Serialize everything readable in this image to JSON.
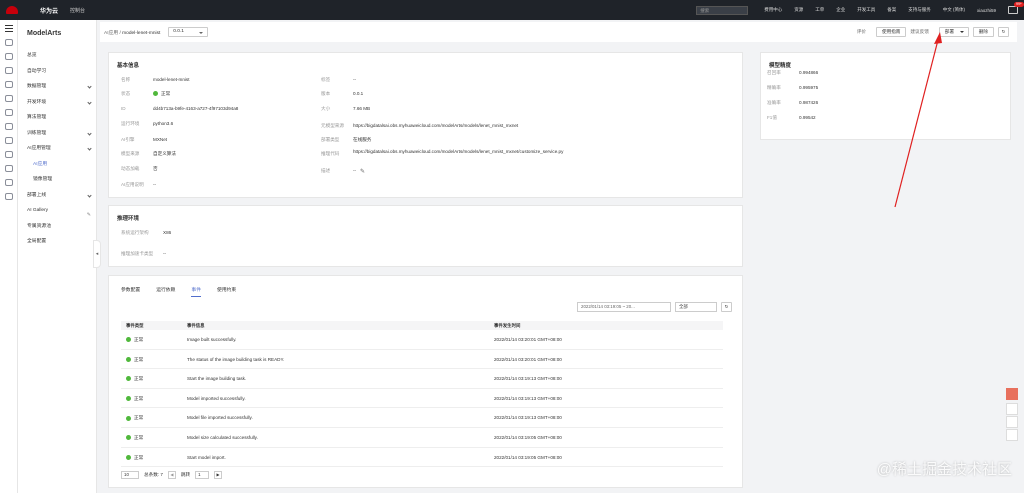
{
  "topbar": {
    "brand": "华为云",
    "console": "控制台",
    "search_placeholder": "搜索",
    "links": [
      "费用中心",
      "资源",
      "工单",
      "企业",
      "开发工具",
      "备案",
      "支持与服务",
      "中文 (简体)",
      "xiaozhi59"
    ],
    "msg_badge": "99+"
  },
  "sidebar": {
    "title": "ModelArts",
    "items": [
      {
        "label": "总览",
        "sub": false,
        "chevron": false
      },
      {
        "label": "自动学习",
        "sub": false,
        "chevron": false
      },
      {
        "label": "数据管理",
        "sub": false,
        "chevron": true
      },
      {
        "label": "开发环境",
        "sub": false,
        "chevron": true
      },
      {
        "label": "算法管理",
        "sub": false,
        "chevron": false
      },
      {
        "label": "训练管理",
        "sub": false,
        "chevron": true
      },
      {
        "label": "AI应用管理",
        "sub": false,
        "chevron": true
      },
      {
        "label": "AI应用",
        "sub": true,
        "active": true
      },
      {
        "label": "镜像管理",
        "sub": true
      },
      {
        "label": "部署上线",
        "sub": false,
        "chevron": true
      },
      {
        "label": "AI Gallery",
        "sub": false,
        "pen": true
      },
      {
        "label": "专属资源池",
        "sub": false
      },
      {
        "label": "全局配置",
        "sub": false
      }
    ]
  },
  "breadcrumb": {
    "parent": "AI应用",
    "separator": "/",
    "current": "model-lenet-mnist",
    "version": "0.0.1"
  },
  "toolbar": {
    "feedback": "评价",
    "guide": "使用指南",
    "prereq": "建议反馈",
    "deploy": "部署",
    "delete": "删除"
  },
  "basic_info": {
    "title": "基本信息",
    "left": [
      {
        "label": "名称",
        "value": "model-lenet-mnist"
      },
      {
        "label": "状态",
        "value": "正常",
        "status": "ok"
      },
      {
        "label": "ID",
        "value": "dd4b713a-b9fe-4163-a727-4f97103d94a8"
      },
      {
        "label": "运行环境",
        "value": "python3.6"
      },
      {
        "label": "AI引擎",
        "value": "MXNet"
      },
      {
        "label": "模型来源",
        "value": "自定义算法"
      },
      {
        "label": "动态加载",
        "value": "否"
      },
      {
        "label": "AI应用说明",
        "value": "--"
      }
    ],
    "right": [
      {
        "label": "标签",
        "value": "--"
      },
      {
        "label": "版本",
        "value": "0.0.1"
      },
      {
        "label": "大小",
        "value": "7.66 MB"
      },
      {
        "label": "元模型来源",
        "value": "https://bigdatalsai.obs.myhuaweicloud.com/modelArts/models/lenet_mnist_mxnet"
      },
      {
        "label": "部署类型",
        "value": "在线服务"
      },
      {
        "label": "推理代码",
        "value": "https://bigdatalsai.obs.myhuaweicloud.com/modelArts/models/lenet_mnist_mxnet/customize_service.py"
      },
      {
        "label": "描述",
        "value": "--"
      }
    ]
  },
  "inference_env": {
    "title": "推理环境",
    "rows": [
      {
        "label": "系统运行架构",
        "value": "X86"
      },
      {
        "label": "推理加速卡类型",
        "value": "--"
      }
    ]
  },
  "model_precision": {
    "title": "模型精度",
    "rows": [
      {
        "label": "召回率",
        "value": "0.994866"
      },
      {
        "label": "精确率",
        "value": "0.995975"
      },
      {
        "label": "准确率",
        "value": "0.987426"
      },
      {
        "label": "F1值",
        "value": "0.99542"
      }
    ]
  },
  "events": {
    "tabs": [
      "参数配置",
      "运行依赖",
      "事件",
      "使用约束"
    ],
    "active_tab": 2,
    "date_range": "2022/01/14 03:19:05  ~  20...",
    "filter": "全部",
    "columns": [
      "事件类型",
      "事件信息",
      "事件发生时间"
    ],
    "rows": [
      {
        "type": "正常",
        "info": "Image built successfully.",
        "time": "2022/01/14 03:20:01 GMT+08:00"
      },
      {
        "type": "正常",
        "info": "The status of the image building task is READY.",
        "time": "2022/01/14 03:20:01 GMT+08:00"
      },
      {
        "type": "正常",
        "info": "Start the image building task.",
        "time": "2022/01/14 03:19:13 GMT+08:00"
      },
      {
        "type": "正常",
        "info": "Model imported successfully.",
        "time": "2022/01/14 03:19:13 GMT+08:00"
      },
      {
        "type": "正常",
        "info": "Model file imported successfully.",
        "time": "2022/01/14 03:19:13 GMT+08:00"
      },
      {
        "type": "正常",
        "info": "Model size calculated successfully.",
        "time": "2022/01/14 03:19:05 GMT+08:00"
      },
      {
        "type": "正常",
        "info": "Start model import.",
        "time": "2022/01/14 03:19:05 GMT+08:00"
      }
    ],
    "page_size": "10",
    "total_label": "总条数: 7",
    "goto_label": "跳转",
    "goto_value": "1"
  },
  "watermark": "@稀土掘金技术社区",
  "colors": {
    "accent": "#526ecc",
    "ok": "#50b83c",
    "arrow": "#e02020",
    "topbar": "#1f2329"
  }
}
